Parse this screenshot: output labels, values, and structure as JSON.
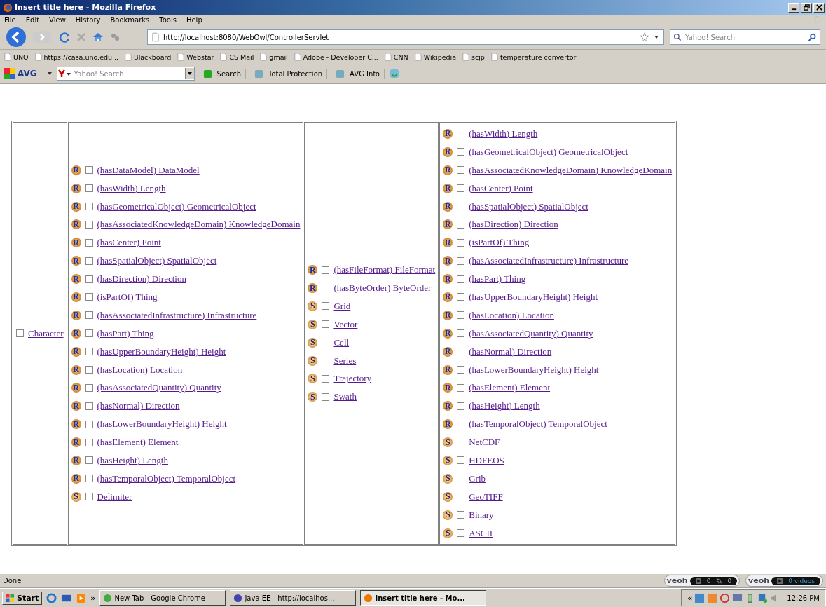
{
  "window": {
    "title": "Insert title here - Mozilla Firefox"
  },
  "menu": [
    "File",
    "Edit",
    "View",
    "History",
    "Bookmarks",
    "Tools",
    "Help"
  ],
  "navigation": {
    "url": "http://localhost:8080/WebOwl/ControllerServlet",
    "search_placeholder": "Yahoo! Search"
  },
  "bookmarks": [
    "UNO",
    "https://casa.uno.edu...",
    "Blackboard",
    "Webstar",
    "CS Mail",
    "gmail",
    "Adobe - Developer C...",
    "CNN",
    "Wikipedia",
    "scjp",
    "temperature convertor"
  ],
  "avg_toolbar": {
    "logo": "AVG",
    "search_placeholder": "Yahoo! Search",
    "buttons": [
      "Search",
      "Total Protection",
      "AVG Info"
    ]
  },
  "table": {
    "columns": [
      {
        "items": [
          {
            "label": "Character",
            "checked": false
          }
        ]
      },
      {
        "items": [
          {
            "badge": "R",
            "label": "(hasDataModel) DataModel",
            "checked": false
          },
          {
            "badge": "R",
            "label": "(hasWidth) Length",
            "checked": false
          },
          {
            "badge": "R",
            "label": "(hasGeometricalObject) GeometricalObject",
            "checked": false
          },
          {
            "badge": "R",
            "label": "(hasAssociatedKnowledgeDomain) KnowledgeDomain",
            "checked": false
          },
          {
            "badge": "R",
            "label": "(hasCenter) Point",
            "checked": false
          },
          {
            "badge": "R",
            "label": "(hasSpatialObject) SpatialObject",
            "checked": false
          },
          {
            "badge": "R",
            "label": "(hasDirection) Direction",
            "checked": false
          },
          {
            "badge": "R",
            "label": "(isPartOf) Thing",
            "checked": false
          },
          {
            "badge": "R",
            "label": "(hasAssociatedInfrastructure) Infrastructure",
            "checked": false
          },
          {
            "badge": "R",
            "label": "(hasPart) Thing",
            "checked": false
          },
          {
            "badge": "R",
            "label": "(hasUpperBoundaryHeight) Height",
            "checked": false
          },
          {
            "badge": "R",
            "label": "(hasLocation) Location",
            "checked": false
          },
          {
            "badge": "R",
            "label": "(hasAssociatedQuantity) Quantity",
            "checked": false
          },
          {
            "badge": "R",
            "label": "(hasNormal) Direction",
            "checked": false
          },
          {
            "badge": "R",
            "label": "(hasLowerBoundaryHeight) Height",
            "checked": false
          },
          {
            "badge": "R",
            "label": "(hasElement) Element",
            "checked": false
          },
          {
            "badge": "R",
            "label": "(hasHeight) Length",
            "checked": false
          },
          {
            "badge": "R",
            "label": "(hasTemporalObject) TemporalObject",
            "checked": false
          },
          {
            "badge": "S",
            "label": "Delimiter",
            "checked": false
          }
        ]
      },
      {
        "items": [
          {
            "badge": "R",
            "label": "(hasFileFormat) FileFormat",
            "checked": false
          },
          {
            "badge": "R",
            "label": "(hasByteOrder) ByteOrder",
            "checked": false
          },
          {
            "badge": "S",
            "label": "Grid",
            "checked": false
          },
          {
            "badge": "S",
            "label": "Vector",
            "checked": false
          },
          {
            "badge": "S",
            "label": "Cell",
            "checked": false
          },
          {
            "badge": "S",
            "label": "Series",
            "checked": false
          },
          {
            "badge": "S",
            "label": "Trajectory",
            "checked": false
          },
          {
            "badge": "S",
            "label": "Swath",
            "checked": false
          }
        ]
      },
      {
        "items": [
          {
            "badge": "R",
            "label": "(hasWidth) Length",
            "checked": false
          },
          {
            "badge": "R",
            "label": "(hasGeometricalObject) GeometricalObject",
            "checked": false
          },
          {
            "badge": "R",
            "label": "(hasAssociatedKnowledgeDomain) KnowledgeDomain",
            "checked": false
          },
          {
            "badge": "R",
            "label": "(hasCenter) Point",
            "checked": false
          },
          {
            "badge": "R",
            "label": "(hasSpatialObject) SpatialObject",
            "checked": false
          },
          {
            "badge": "R",
            "label": "(hasDirection) Direction",
            "checked": false
          },
          {
            "badge": "R",
            "label": "(isPartOf) Thing",
            "checked": false
          },
          {
            "badge": "R",
            "label": "(hasAssociatedInfrastructure) Infrastructure",
            "checked": false
          },
          {
            "badge": "R",
            "label": "(hasPart) Thing",
            "checked": false
          },
          {
            "badge": "R",
            "label": "(hasUpperBoundaryHeight) Height",
            "checked": false
          },
          {
            "badge": "R",
            "label": "(hasLocation) Location",
            "checked": false
          },
          {
            "badge": "R",
            "label": "(hasAssociatedQuantity) Quantity",
            "checked": false
          },
          {
            "badge": "R",
            "label": "(hasNormal) Direction",
            "checked": false
          },
          {
            "badge": "R",
            "label": "(hasLowerBoundaryHeight) Height",
            "checked": false
          },
          {
            "badge": "R",
            "label": "(hasElement) Element",
            "checked": false
          },
          {
            "badge": "R",
            "label": "(hasHeight) Length",
            "checked": false
          },
          {
            "badge": "R",
            "label": "(hasTemporalObject) TemporalObject",
            "checked": false
          },
          {
            "badge": "S",
            "label": "NetCDF",
            "checked": false
          },
          {
            "badge": "S",
            "label": "HDFEOS",
            "checked": false
          },
          {
            "badge": "S",
            "label": "Grib",
            "checked": false
          },
          {
            "badge": "S",
            "label": "GeoTIFF",
            "checked": false
          },
          {
            "badge": "S",
            "label": "Binary",
            "checked": false
          },
          {
            "badge": "S",
            "label": "ASCII",
            "checked": false
          }
        ]
      }
    ]
  },
  "status_bar": {
    "text": "Done",
    "widgets": [
      {
        "logo": "veoh",
        "readings": [
          "0",
          "0"
        ]
      },
      {
        "logo": "veoh",
        "readings": [
          "0 videos"
        ]
      }
    ]
  },
  "taskbar": {
    "start": "Start",
    "more": "»",
    "tasks": [
      {
        "label": "New Tab - Google Chrome",
        "selected": false
      },
      {
        "label": "Java EE - http://localhos...",
        "selected": false
      },
      {
        "label": "Insert title here - Mo...",
        "selected": true
      }
    ],
    "tray_more": "«",
    "clock": "12:26 PM"
  }
}
